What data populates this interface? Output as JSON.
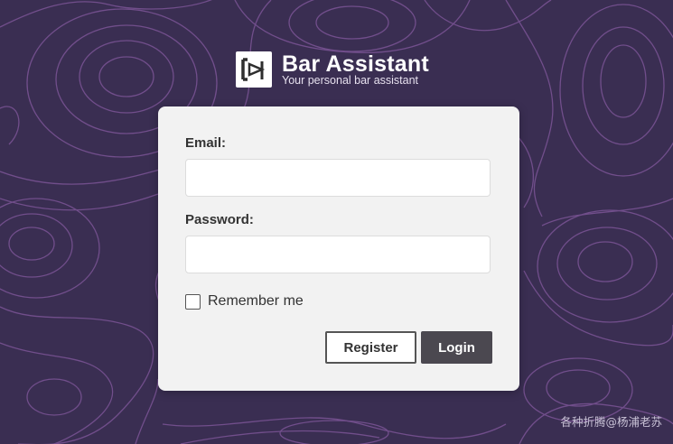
{
  "app": {
    "title": "Bar Assistant",
    "subtitle": "Your personal bar assistant",
    "logo_icon": "bar-assistant-logo-icon"
  },
  "colors": {
    "background": "#3a2e52",
    "contour_lines": "#7b5496",
    "card": "#f2f2f2",
    "login_button": "#4b4850"
  },
  "login_form": {
    "email_label": "Email:",
    "email_value": "",
    "password_label": "Password:",
    "password_value": "",
    "remember_label": "Remember me",
    "remember_checked": false,
    "register_button": "Register",
    "login_button": "Login"
  },
  "watermark": "各种折腾@杨浦老苏"
}
